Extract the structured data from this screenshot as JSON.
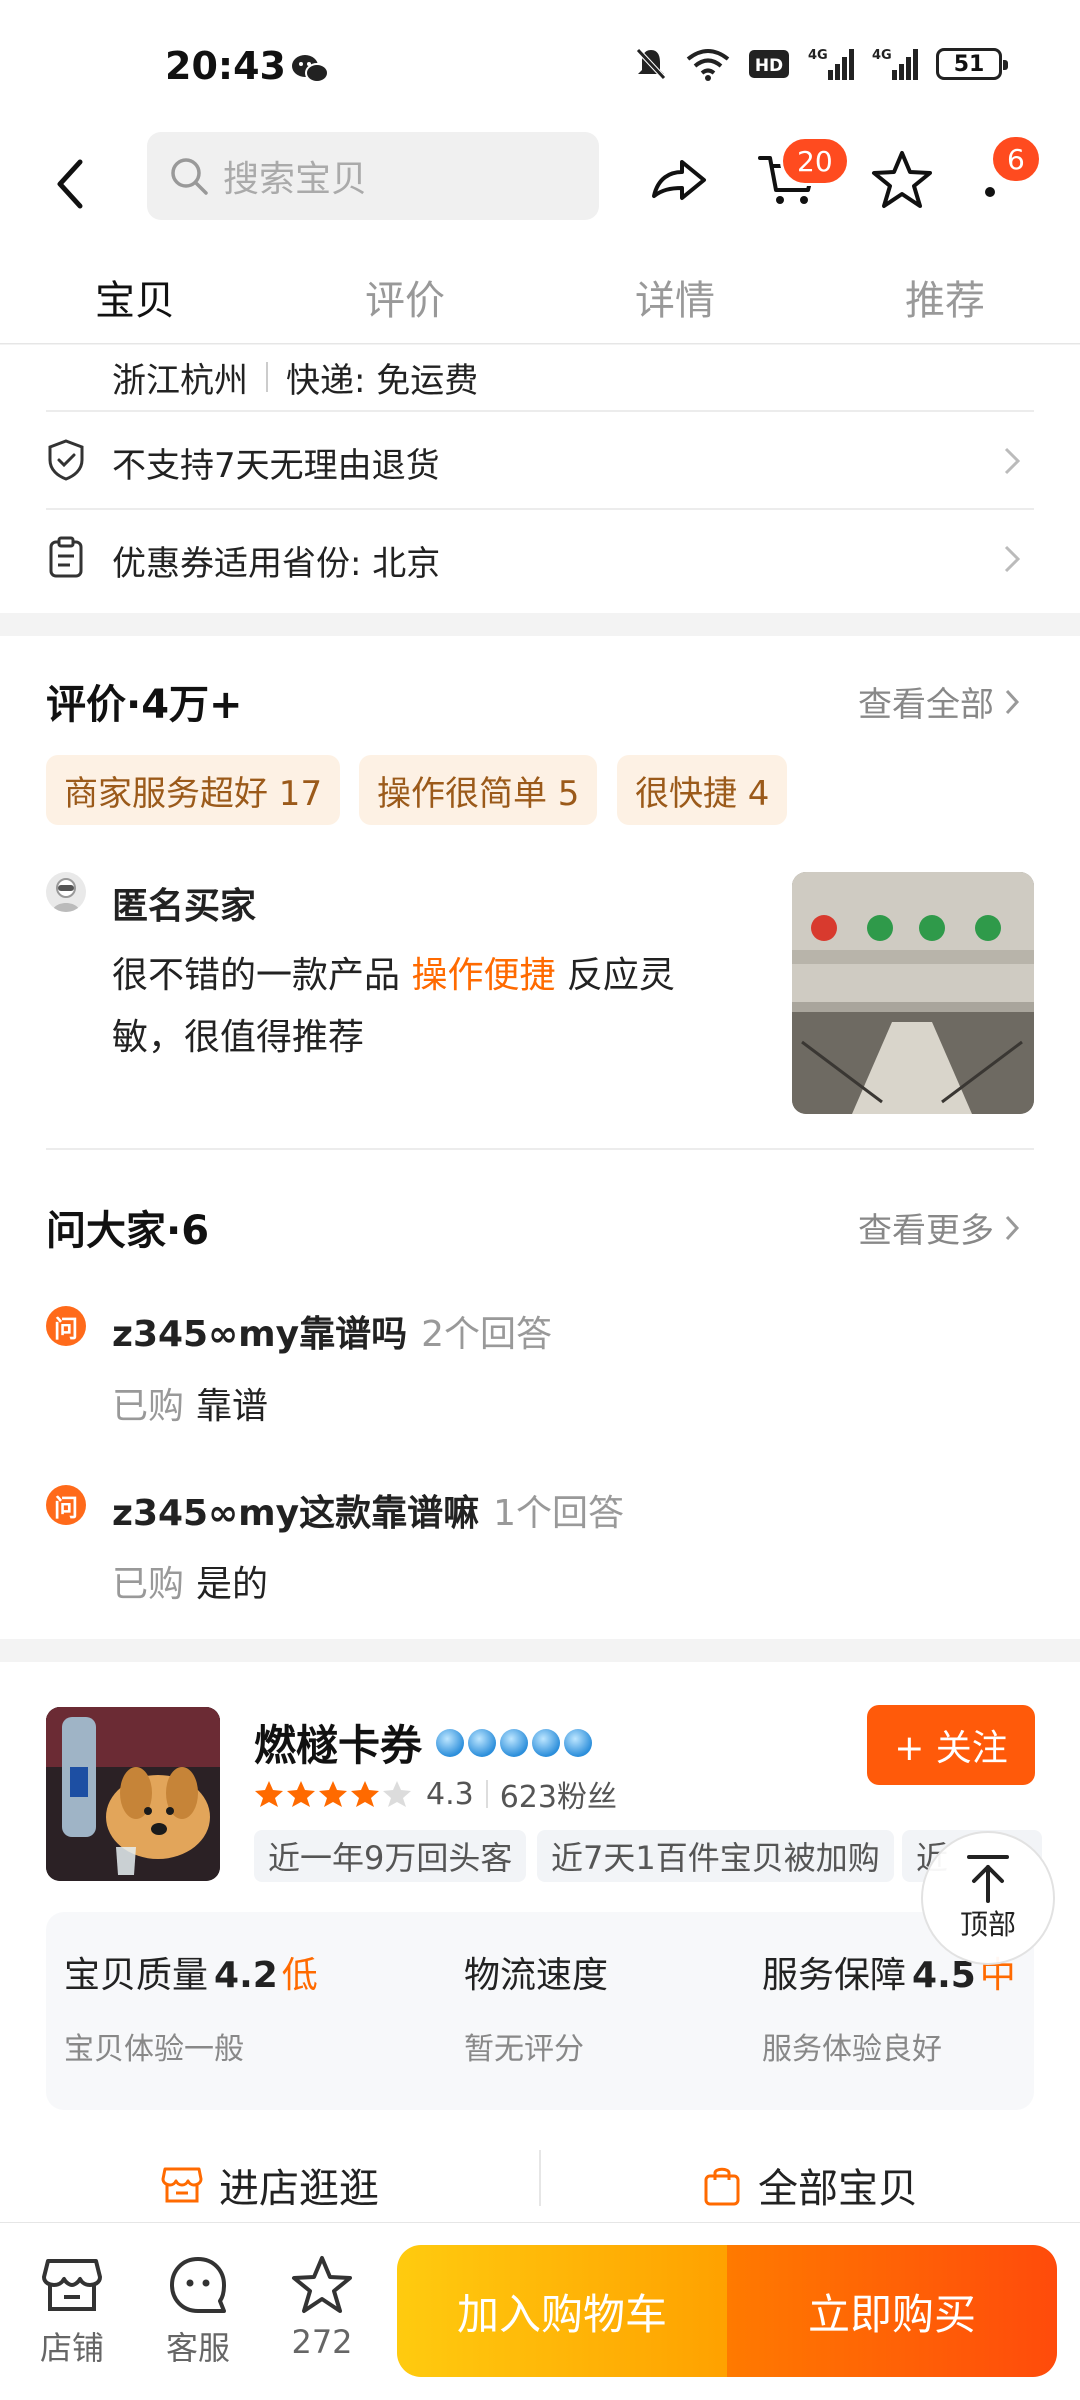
{
  "status_bar": {
    "time": "20:43",
    "icons": [
      "wechat-icon",
      "mute-icon",
      "wifi-icon",
      "hd-icon",
      "signal-4g-icon",
      "signal-4g-icon"
    ],
    "battery": "51"
  },
  "nav": {
    "search_placeholder": "搜索宝贝",
    "cart_badge": "20",
    "more_badge": "6"
  },
  "tabs": [
    {
      "label": "宝贝",
      "active": true
    },
    {
      "label": "评价",
      "active": false
    },
    {
      "label": "详情",
      "active": false
    },
    {
      "label": "推荐",
      "active": false
    }
  ],
  "shipping": {
    "location": "浙江杭州",
    "express": "快递: 免运费"
  },
  "service_rows": [
    {
      "icon": "shield-icon",
      "label": "不支持7天无理由退货"
    },
    {
      "icon": "coupon-icon",
      "label": "优惠券适用省份: 北京"
    }
  ],
  "reviews": {
    "title": "评价·4万+",
    "more": "查看全部",
    "tags": [
      "商家服务超好 17",
      "操作很简单 5",
      "很快捷 4"
    ],
    "item": {
      "user": "匿名买家",
      "text_before": "很不错的一款产品 ",
      "highlight": "操作便捷",
      "text_after": " 反应灵敏，很值得推荐"
    }
  },
  "qa": {
    "title": "问大家·6",
    "more": "查看更多",
    "icon_label": "问",
    "items": [
      {
        "question": "z345∞my靠谱吗",
        "count": "2个回答",
        "bought": "已购",
        "answer": "靠谱"
      },
      {
        "question": "z345∞my这款靠谱嘛",
        "count": "1个回答",
        "bought": "已购",
        "answer": "是的"
      }
    ]
  },
  "shop": {
    "name": "燃檖卡券",
    "rating": "4.3",
    "stars_filled": 4,
    "followers": "623粉丝",
    "follow_label": "+ 关注",
    "tags": [
      "近一年9万回头客",
      "近7天1百件宝贝被加购",
      "近"
    ],
    "scores": [
      {
        "label": "宝贝质量",
        "value": "4.2",
        "level": "低",
        "sub": "宝贝体验一般"
      },
      {
        "label": "物流速度",
        "value": "",
        "level": "",
        "sub": "暂无评分"
      },
      {
        "label": "服务保障",
        "value": "4.5",
        "level": "中",
        "sub": "服务体验良好"
      }
    ],
    "enter_shop": "进店逛逛",
    "all_items": "全部宝贝"
  },
  "top_button": "顶部",
  "bottom_bar": {
    "shop": "店铺",
    "service": "客服",
    "favorites": "272",
    "add_cart": "加入购物车",
    "buy_now": "立即购买"
  },
  "colors": {
    "accent": "#ff6a00",
    "badge": "#ff4b1f",
    "follow": "#ff5a0a",
    "cart_gradient": [
      "#ffcb0f",
      "#ffa100"
    ],
    "buy_gradient": [
      "#ff7a00",
      "#ff4b0b"
    ]
  }
}
